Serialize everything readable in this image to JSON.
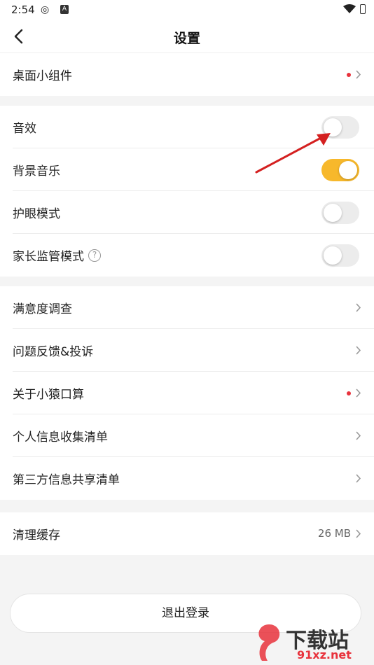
{
  "status_bar": {
    "time": "2:54"
  },
  "header": {
    "title": "设置"
  },
  "groups": {
    "widgets": {
      "label": "桌面小组件"
    },
    "sound_effects": {
      "label": "音效",
      "on": false
    },
    "background_music": {
      "label": "背景音乐",
      "on": true
    },
    "eye_protection": {
      "label": "护眼模式",
      "on": false
    },
    "parental_mode": {
      "label": "家长监管模式",
      "help_icon": "?",
      "on": false
    },
    "survey": {
      "label": "满意度调查"
    },
    "feedback": {
      "label": "问题反馈&投诉"
    },
    "about": {
      "label": "关于小猿口算"
    },
    "personal_info": {
      "label": "个人信息收集清单"
    },
    "third_party": {
      "label": "第三方信息共享清单"
    },
    "cache": {
      "label": "清理缓存",
      "value": "26 MB"
    }
  },
  "logout_label": "退出登录",
  "watermark": {
    "brand": "下载站",
    "url": "91xz.net"
  },
  "colors": {
    "toggle_on": "#f7b82b",
    "badge_dot": "#e8323c",
    "annotation_arrow": "#d42020"
  }
}
